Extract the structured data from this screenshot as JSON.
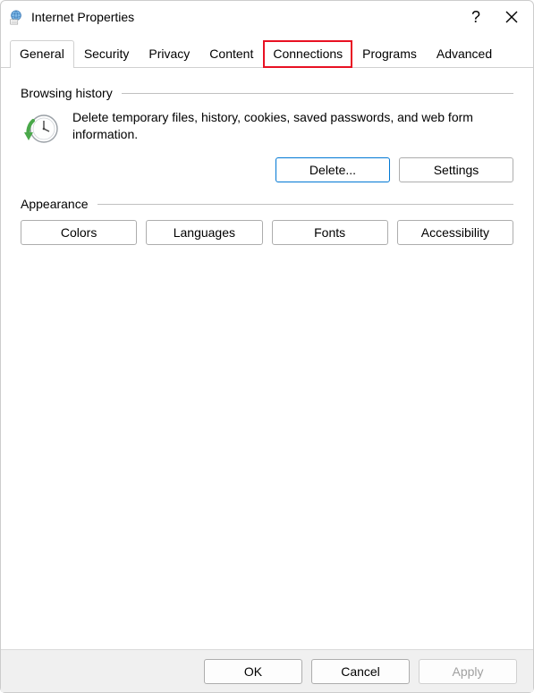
{
  "window": {
    "title": "Internet Properties"
  },
  "tabs": {
    "general": "General",
    "security": "Security",
    "privacy": "Privacy",
    "content": "Content",
    "connections": "Connections",
    "programs": "Programs",
    "advanced": "Advanced"
  },
  "browsing_history": {
    "label": "Browsing history",
    "description": "Delete temporary files, history, cookies, saved passwords, and web form information.",
    "delete_btn": "Delete...",
    "settings_btn": "Settings"
  },
  "appearance": {
    "label": "Appearance",
    "colors_btn": "Colors",
    "languages_btn": "Languages",
    "fonts_btn": "Fonts",
    "accessibility_btn": "Accessibility"
  },
  "footer": {
    "ok": "OK",
    "cancel": "Cancel",
    "apply": "Apply"
  }
}
